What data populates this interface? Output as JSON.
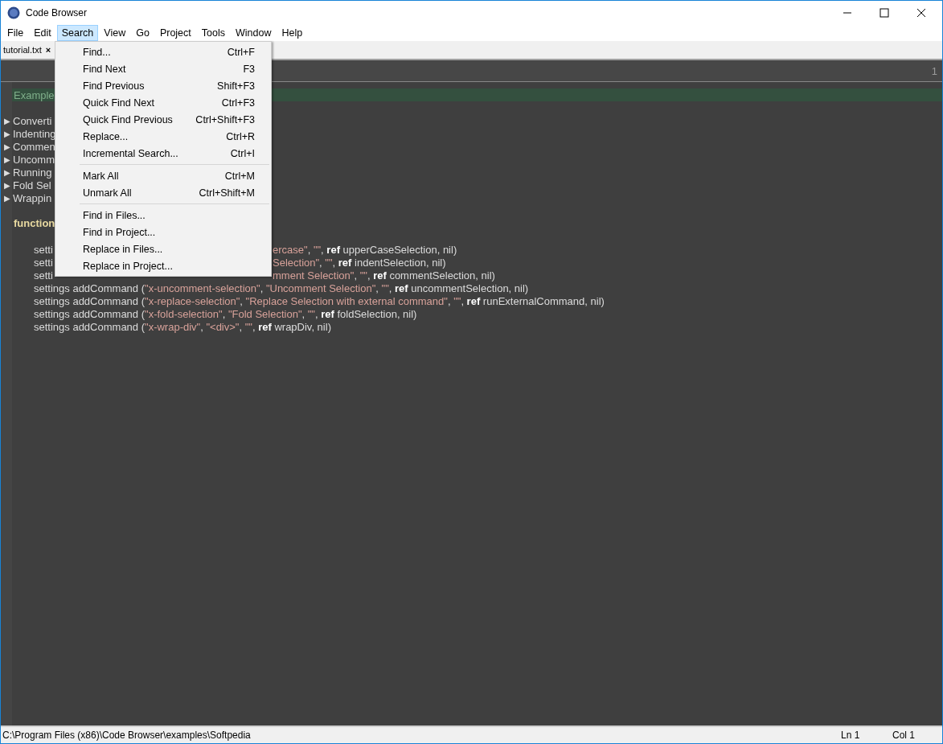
{
  "window": {
    "title": "Code Browser"
  },
  "menubar": [
    {
      "label": "File",
      "selected": false
    },
    {
      "label": "Edit",
      "selected": false
    },
    {
      "label": "Search",
      "selected": true
    },
    {
      "label": "View",
      "selected": false
    },
    {
      "label": "Go",
      "selected": false
    },
    {
      "label": "Project",
      "selected": false
    },
    {
      "label": "Tools",
      "selected": false
    },
    {
      "label": "Window",
      "selected": false
    },
    {
      "label": "Help",
      "selected": false
    }
  ],
  "tabs": [
    {
      "label": "tutorial.txt",
      "close": "×",
      "selected": true
    }
  ],
  "editor": {
    "line_number": "1",
    "heading": "Example",
    "folds": [
      {
        "marker": "▶",
        "label": "Converti"
      },
      {
        "marker": "▶",
        "label": "Indenting"
      },
      {
        "marker": "▶",
        "label": "Commen"
      },
      {
        "marker": "▶",
        "label": "Uncomm"
      },
      {
        "marker": "▶",
        "label": "Running"
      },
      {
        "marker": "▶",
        "label": "Fold Sel"
      },
      {
        "marker": "▶",
        "label": "Wrappin"
      }
    ],
    "function_line": "function",
    "code_lines": [
      {
        "left": "setti",
        "tokens": [
          {
            "kind": "string",
            "text": "ercase\""
          },
          {
            "kind": "plain",
            "text": ", "
          },
          {
            "kind": "string",
            "text": "\"\""
          },
          {
            "kind": "plain",
            "text": ", "
          },
          {
            "kind": "keyword",
            "text": "ref"
          },
          {
            "kind": "plain",
            "text": " upperCaseSelection, nil)"
          }
        ]
      },
      {
        "left": "setti",
        "tokens": [
          {
            "kind": "string",
            "text": " Selection\""
          },
          {
            "kind": "plain",
            "text": ", "
          },
          {
            "kind": "string",
            "text": "\"\""
          },
          {
            "kind": "plain",
            "text": ", "
          },
          {
            "kind": "keyword",
            "text": "ref"
          },
          {
            "kind": "plain",
            "text": " indentSelection, nil)"
          }
        ]
      },
      {
        "left": "setti",
        "tokens": [
          {
            "kind": "string",
            "text": "mment Selection\""
          },
          {
            "kind": "plain",
            "text": ", "
          },
          {
            "kind": "string",
            "text": "\"\""
          },
          {
            "kind": "plain",
            "text": ", "
          },
          {
            "kind": "keyword",
            "text": "ref"
          },
          {
            "kind": "plain",
            "text": " commentSelection, nil)"
          }
        ]
      },
      {
        "tokens": [
          {
            "kind": "plain",
            "text": "settings addCommand ("
          },
          {
            "kind": "string",
            "text": "\"x-uncomment-selection\""
          },
          {
            "kind": "plain",
            "text": ", "
          },
          {
            "kind": "string",
            "text": "\"Uncomment Selection\""
          },
          {
            "kind": "plain",
            "text": ", "
          },
          {
            "kind": "string",
            "text": "\"\""
          },
          {
            "kind": "plain",
            "text": ", "
          },
          {
            "kind": "keyword",
            "text": "ref"
          },
          {
            "kind": "plain",
            "text": " uncommentSelection, nil)"
          }
        ]
      },
      {
        "tokens": [
          {
            "kind": "plain",
            "text": "settings addCommand ("
          },
          {
            "kind": "string",
            "text": "\"x-replace-selection\""
          },
          {
            "kind": "plain",
            "text": ", "
          },
          {
            "kind": "string",
            "text": "\"Replace Selection with external command\""
          },
          {
            "kind": "plain",
            "text": ", "
          },
          {
            "kind": "string",
            "text": "\"\""
          },
          {
            "kind": "plain",
            "text": ", "
          },
          {
            "kind": "keyword",
            "text": "ref"
          },
          {
            "kind": "plain",
            "text": " runExternalCommand, nil)"
          }
        ]
      },
      {
        "tokens": [
          {
            "kind": "plain",
            "text": "settings addCommand ("
          },
          {
            "kind": "string",
            "text": "\"x-fold-selection\""
          },
          {
            "kind": "plain",
            "text": ", "
          },
          {
            "kind": "string",
            "text": "\"Fold Selection\""
          },
          {
            "kind": "plain",
            "text": ", "
          },
          {
            "kind": "string",
            "text": "\"\""
          },
          {
            "kind": "plain",
            "text": ", "
          },
          {
            "kind": "keyword",
            "text": "ref"
          },
          {
            "kind": "plain",
            "text": " foldSelection, nil)"
          }
        ]
      },
      {
        "tokens": [
          {
            "kind": "plain",
            "text": "settings addCommand ("
          },
          {
            "kind": "string",
            "text": "\"x-wrap-div\""
          },
          {
            "kind": "plain",
            "text": ", "
          },
          {
            "kind": "string",
            "text": "\"<div>\""
          },
          {
            "kind": "plain",
            "text": ", "
          },
          {
            "kind": "string",
            "text": "\"\""
          },
          {
            "kind": "plain",
            "text": ", "
          },
          {
            "kind": "keyword",
            "text": "ref"
          },
          {
            "kind": "plain",
            "text": " wrapDiv, nil)"
          }
        ]
      }
    ]
  },
  "search_menu": [
    {
      "kind": "item",
      "label": "Find...",
      "shortcut": "Ctrl+F"
    },
    {
      "kind": "item",
      "label": "Find Next",
      "shortcut": "F3"
    },
    {
      "kind": "item",
      "label": "Find Previous",
      "shortcut": "Shift+F3"
    },
    {
      "kind": "item",
      "label": "Quick Find Next",
      "shortcut": "Ctrl+F3"
    },
    {
      "kind": "item",
      "label": "Quick Find Previous",
      "shortcut": "Ctrl+Shift+F3"
    },
    {
      "kind": "item",
      "label": "Replace...",
      "shortcut": "Ctrl+R"
    },
    {
      "kind": "item",
      "label": "Incremental Search...",
      "shortcut": "Ctrl+I"
    },
    {
      "kind": "separator"
    },
    {
      "kind": "item",
      "label": "Mark All",
      "shortcut": "Ctrl+M"
    },
    {
      "kind": "item",
      "label": "Unmark All",
      "shortcut": "Ctrl+Shift+M"
    },
    {
      "kind": "separator"
    },
    {
      "kind": "item",
      "label": "Find in Files..."
    },
    {
      "kind": "item",
      "label": "Find in Project..."
    },
    {
      "kind": "item",
      "label": "Replace in Files..."
    },
    {
      "kind": "item",
      "label": "Replace in Project..."
    }
  ],
  "status_bar": {
    "path": "C:\\Program Files (x86)\\Code Browser\\examples\\Softpedia",
    "line": "Ln 1",
    "column": "Col 1"
  }
}
